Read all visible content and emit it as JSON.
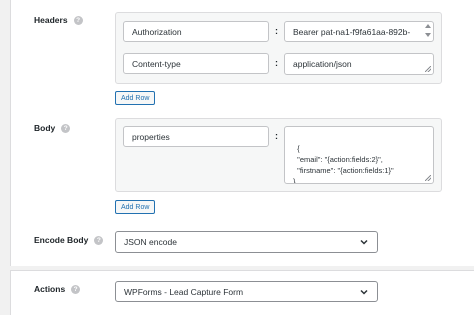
{
  "headers": {
    "label": "Headers",
    "rows": [
      {
        "key": "Authorization",
        "value": "Bearer pat-na1-f9fa61aa-892b-"
      },
      {
        "key": "Content-type",
        "value": "application/json"
      }
    ],
    "add_row": "Add Row"
  },
  "body": {
    "label": "Body",
    "key": "properties",
    "value": "{\n  \"email\": \"{action:fields:2}\",\n  \"firstname\": \"{action:fields:1}\"\n}",
    "add_row": "Add Row"
  },
  "encode_body": {
    "label": "Encode Body",
    "selected": "JSON encode"
  },
  "actions": {
    "label": "Actions",
    "selected": "WPForms - Lead Capture Form"
  },
  "separator": ":",
  "help_glyph": "?"
}
